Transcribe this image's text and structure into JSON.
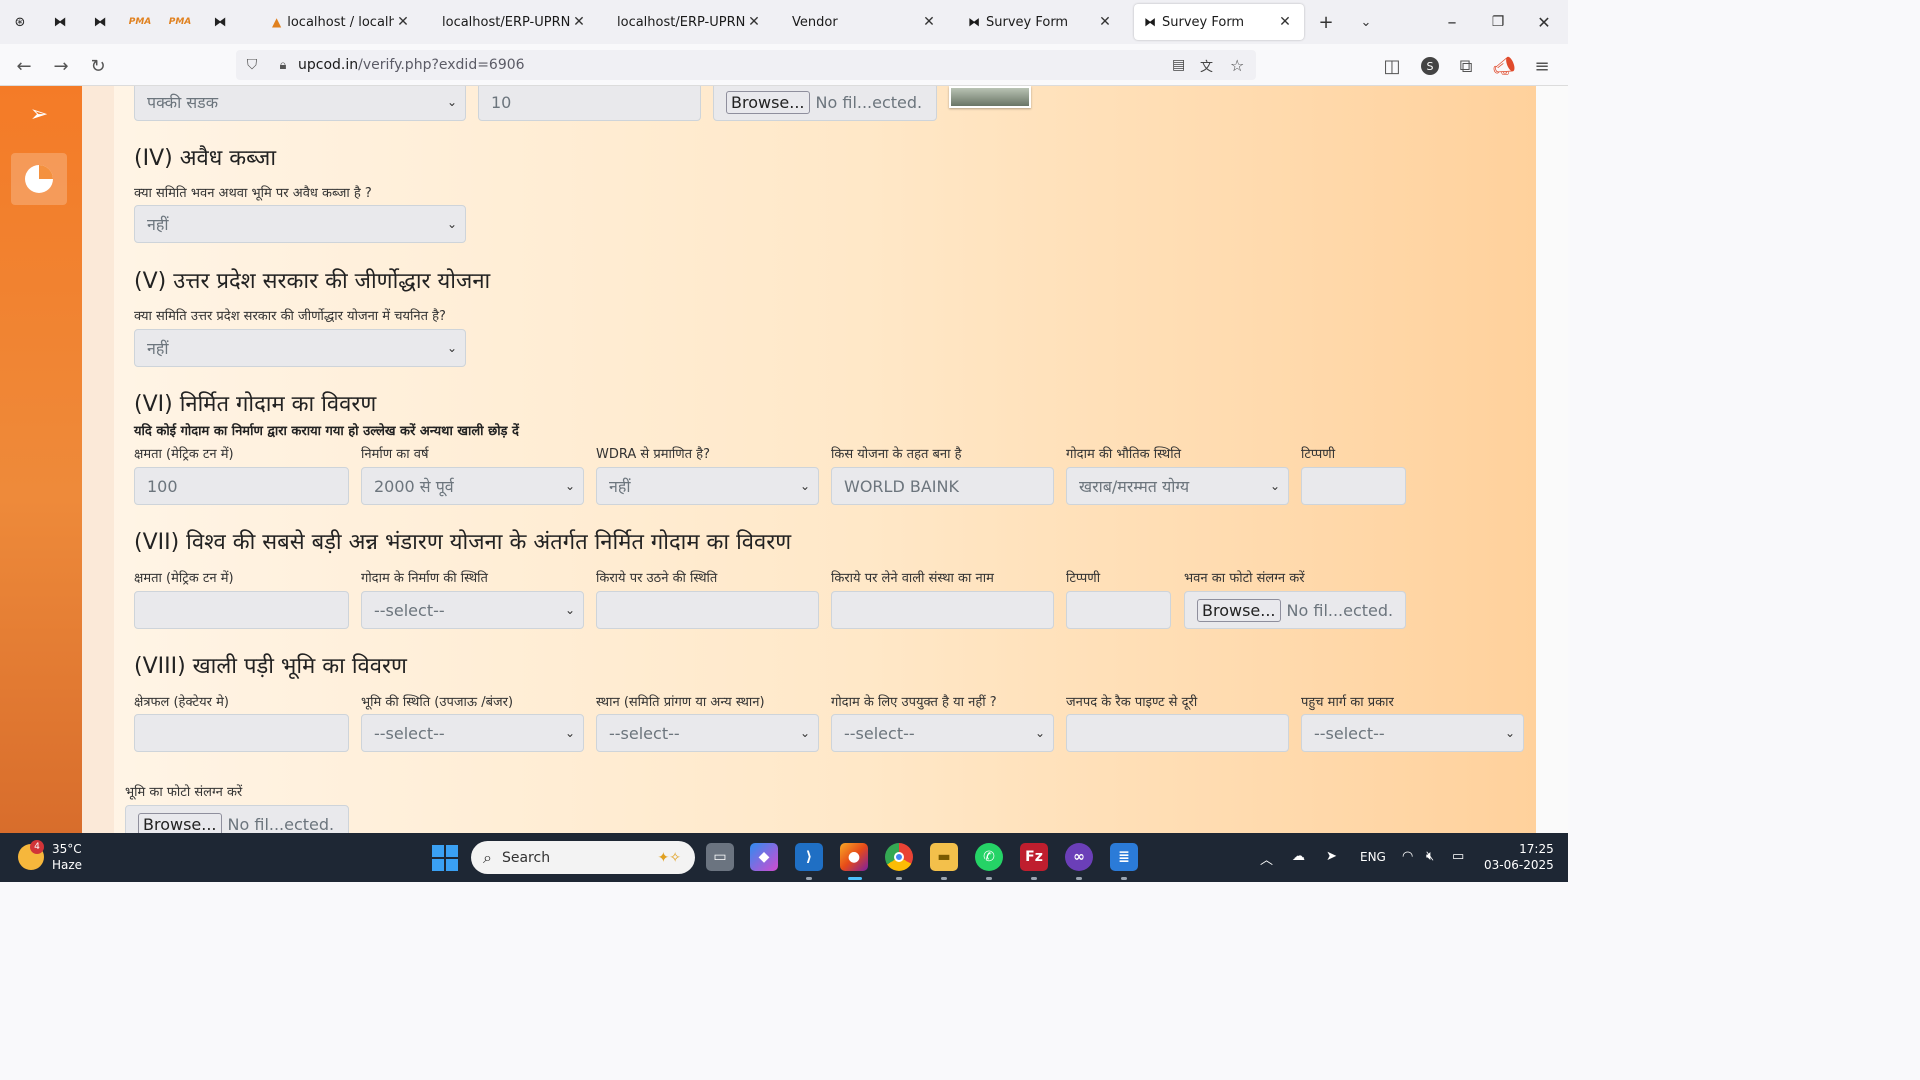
{
  "browser": {
    "pinned_tabs": [
      "chatgpt-icon",
      "mask-icon",
      "mask-icon",
      "pma-icon",
      "pma-icon",
      "mask-icon"
    ],
    "pma_label": "PMA",
    "tabs": [
      {
        "label": "localhost / localhost / ",
        "icon": "pma-icon"
      },
      {
        "label": "localhost/ERP-UPRNSS/ve",
        "icon": ""
      },
      {
        "label": "localhost/ERP-UPRNSS/cr",
        "icon": ""
      },
      {
        "label": "Vendor",
        "icon": ""
      },
      {
        "label": "Survey Form",
        "icon": "mask-icon"
      },
      {
        "label": "Survey Form",
        "icon": "mask-icon",
        "active": true
      }
    ],
    "url_host": "upcod.in",
    "url_path": "/verify.php?exdid=6906"
  },
  "form": {
    "top_row": {
      "road_type": "पक्की सडक",
      "distance": "10",
      "file_button": "Browse...",
      "file_text": "No fil...ected."
    },
    "sec4": {
      "title": "(IV) अवैध कब्जा",
      "question": "क्या समिति भवन अथवा भूमि पर अवैध कब्जा है ?",
      "value": "नहीं"
    },
    "sec5": {
      "title": "(V) उत्तर प्रदेश सरकार की जीर्णोद्धार योजना",
      "question": "क्या समिति उत्तर प्रदेश सरकार की जीर्णोद्धार योजना में चयनित है?",
      "value": "नहीं"
    },
    "sec6": {
      "title": "(VI) निर्मित गोदाम का विवरण",
      "subtitle": "यदि कोई गोदाम का निर्माण द्वारा कराया गया हो उल्लेख करें अन्यथा खाली छोड़ दें",
      "labels": [
        "क्षमता (मेट्रिक टन में)",
        "निर्माण का वर्ष",
        "WDRA से प्रमाणित है?",
        "किस योजना के तहत बना है",
        "गोदाम की भौतिक स्थिति",
        "टिप्पणी"
      ],
      "capacity": "100",
      "year": "2000 से पूर्व",
      "wdra": "नहीं",
      "scheme": "WORLD BAINK",
      "condition": "खराब/मरम्मत योग्य",
      "remark": ""
    },
    "sec7": {
      "title": "(VII) विश्व की सबसे बड़ी अन्न भंडारण योजना के अंतर्गत निर्मित गोदाम का विवरण",
      "labels": [
        "क्षमता (मेट्रिक टन में)",
        "गोदाम के निर्माण की स्थिति",
        "किराये पर उठने की स्थिति",
        "किराये पर लेने वाली संस्था का नाम",
        "टिप्पणी",
        "भवन का फोटो संलग्न करें"
      ],
      "select_placeholder": "--select--",
      "file_button": "Browse...",
      "file_text": "No fil...ected."
    },
    "sec8": {
      "title": "(VIII) खाली पड़ी भूमि का विवरण",
      "labels": [
        "क्षेत्रफल (हेक्टेयर मे)",
        "भूमि की स्थिति (उपजाऊ /बंजर)",
        "स्थान (समिति प्रांगण या अन्य स्थान)",
        "गोदाम के लिए उपयुक्त है या नहीं ?",
        "जनपद के रैक पाइण्ट से दूरी",
        "पहुच मार्ग का प्रकार"
      ],
      "select_placeholder": "--select--",
      "photo_label": "भूमि का फोटो संलग्न करें",
      "file_button": "Browse...",
      "file_text": "No fil...ected."
    }
  },
  "taskbar": {
    "weather_temp": "35°C",
    "weather_desc": "Haze",
    "weather_badge": "4",
    "search_placeholder": "Search",
    "lang": "ENG",
    "time": "17:25",
    "date": "03-06-2025"
  },
  "colors": {
    "sidebar_orange": "#f47b27",
    "field_bg": "#e9e9ec",
    "taskbar_bg": "#1e2734"
  }
}
